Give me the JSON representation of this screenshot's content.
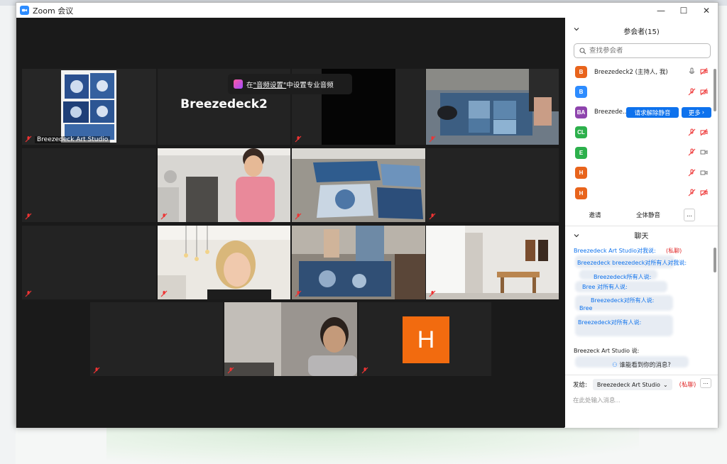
{
  "window": {
    "title": "Zoom 会议",
    "controls": [
      "—",
      "☐",
      "✕"
    ]
  },
  "toast": {
    "prefix": "在",
    "link": "\"音频设置\"",
    "suffix": "中设置专业音频"
  },
  "tiles": [
    {
      "name": "Breezedeck Art Studio",
      "kind": "video-fabric",
      "active": true
    },
    {
      "big_name": "Breezedeck2",
      "kind": "name"
    },
    {
      "kind": "dark"
    },
    {
      "kind": "video-table"
    },
    {
      "kind": "dark"
    },
    {
      "kind": "video-woman-pink"
    },
    {
      "kind": "video-fabric-bed"
    },
    {
      "kind": "dark"
    },
    {
      "kind": "dark"
    },
    {
      "kind": "video-woman-blonde"
    },
    {
      "kind": "video-room-people"
    },
    {
      "kind": "video-room"
    },
    {
      "kind": "dark"
    },
    {
      "kind": "video-woman-dark"
    },
    {
      "avatar": "H",
      "kind": "avatar"
    }
  ],
  "participants_panel": {
    "title": "参会者(15)",
    "search_placeholder": "查找参会者",
    "participants": [
      {
        "initials": "B",
        "name": "Breezedeck2 (主持人, 我)",
        "color": "#e8641c"
      },
      {
        "initials": "B",
        "name": "",
        "color": "#2d8cff"
      },
      {
        "initials": "BA",
        "name": "Breezede...",
        "color": "#8e44ad"
      },
      {
        "initials": "CL",
        "name": "",
        "color": "#2db04c"
      },
      {
        "initials": "E",
        "name": "",
        "color": "#2db04c"
      },
      {
        "initials": "H",
        "name": "",
        "color": "#e8641c"
      },
      {
        "initials": "H",
        "name": "",
        "color": "#e8641c"
      }
    ],
    "request_unmute_label": "请求解除静音",
    "more_label": "更多",
    "invite_label": "邀请",
    "mute_all_label": "全体静音",
    "more_dots": "..."
  },
  "chat_panel": {
    "title": "聊天",
    "first_sender": "Breezedeck Art Studio对我说:",
    "first_private": "(私聊)",
    "msg_lines": [
      "Breezedeck breezedeck对所有人对我说:",
      "Breezedeck所有人说:",
      "Bree 对所有人说:",
      "Breezedeck对所有人说:",
      "Bree",
      "Breezedeck对所有人说:"
    ],
    "last_sender": "Breezeck Art Studio 说:",
    "who_can_see": "谁能看到你的消息?",
    "send_to_label": "发给:",
    "send_to_value": "Breezedeck Art Studio",
    "send_to_private": "(私聊)",
    "input_placeholder": "在此处输入消息...",
    "more_dots": "..."
  },
  "colors": {
    "accent_blue": "#0e72ed",
    "active_speaker": "#d7e38b",
    "avatar_orange": "#f26b0f",
    "private_red": "#e02828"
  }
}
